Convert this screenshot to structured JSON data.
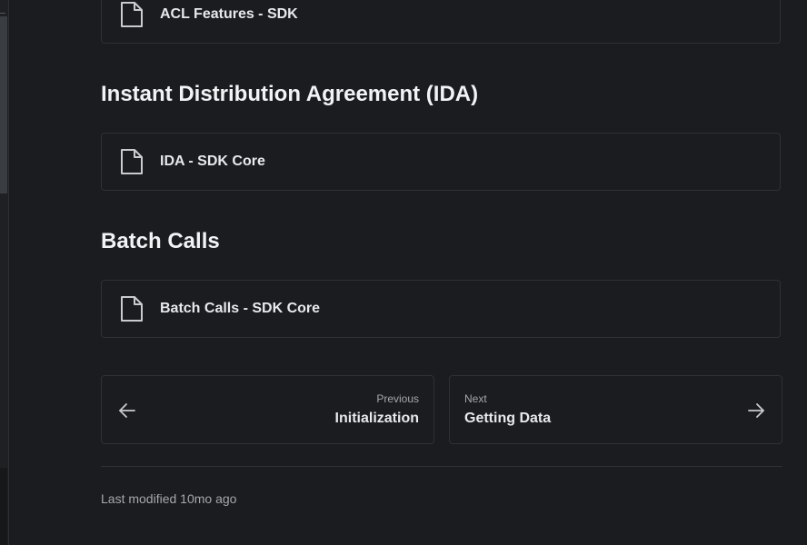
{
  "sections": [
    {
      "heading": "",
      "items": [
        {
          "label": "ACL Features - SDK",
          "icon": "document-icon"
        }
      ]
    },
    {
      "heading": "Instant Distribution Agreement (IDA)",
      "items": [
        {
          "label": "IDA - SDK Core",
          "icon": "document-icon"
        }
      ]
    },
    {
      "heading": "Batch Calls",
      "items": [
        {
          "label": "Batch Calls - SDK Core",
          "icon": "document-icon"
        }
      ]
    }
  ],
  "pagination": {
    "previous": {
      "caption": "Previous",
      "title": "Initialization",
      "icon": "arrow-left-icon"
    },
    "next": {
      "caption": "Next",
      "title": "Getting Data",
      "icon": "arrow-right-icon"
    }
  },
  "footer": {
    "last_modified": "Last modified 10mo ago"
  },
  "colors": {
    "background": "#1a1c1f",
    "border": "#2e3135",
    "text": "#e8e9eb",
    "muted_text": "#a4a7ac"
  }
}
